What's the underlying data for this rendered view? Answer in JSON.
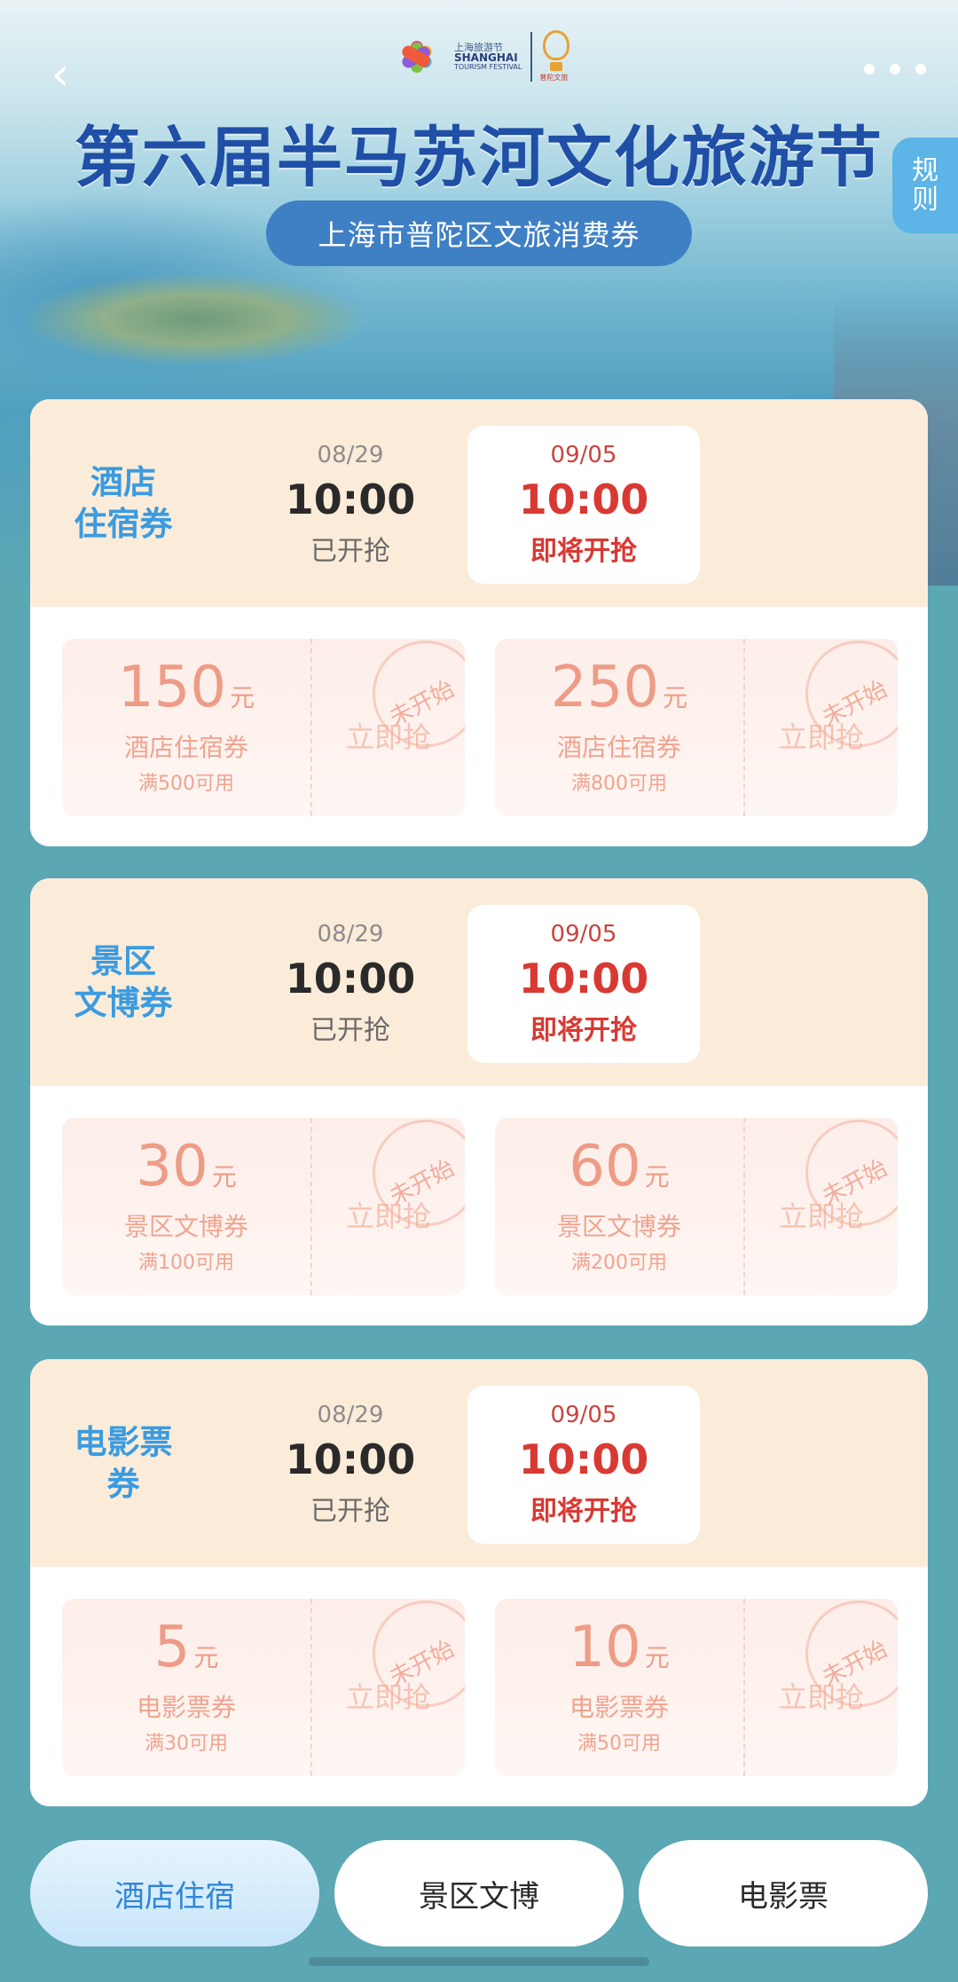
{
  "header": {
    "back_icon": "chevron-left-icon",
    "more_icon": "more-dots-icon",
    "logo": {
      "line1": "上海旅游节",
      "line2": "SHANGHAI",
      "line3": "TOURISM FESTIVAL",
      "right_caption": "普陀文旅"
    },
    "title": "第六届半马苏河文化旅游节",
    "subtitle": "上海市普陀区文旅消费券",
    "rules_label_1": "规",
    "rules_label_2": "则"
  },
  "sections": [
    {
      "title": "酒店\n住宿券",
      "slots": [
        {
          "date": "08/29",
          "time": "10:00",
          "status": "已开抢"
        },
        {
          "date": "09/05",
          "time": "10:00",
          "status": "即将开抢"
        }
      ],
      "coupons": [
        {
          "amount": "150",
          "unit": "元",
          "name": "酒店住宿券",
          "condition": "满500可用",
          "button": "立即抢",
          "stamp": "未开始"
        },
        {
          "amount": "250",
          "unit": "元",
          "name": "酒店住宿券",
          "condition": "满800可用",
          "button": "立即抢",
          "stamp": "未开始"
        }
      ]
    },
    {
      "title": "景区\n文博券",
      "slots": [
        {
          "date": "08/29",
          "time": "10:00",
          "status": "已开抢"
        },
        {
          "date": "09/05",
          "time": "10:00",
          "status": "即将开抢"
        }
      ],
      "coupons": [
        {
          "amount": "30",
          "unit": "元",
          "name": "景区文博券",
          "condition": "满100可用",
          "button": "立即抢",
          "stamp": "未开始"
        },
        {
          "amount": "60",
          "unit": "元",
          "name": "景区文博券",
          "condition": "满200可用",
          "button": "立即抢",
          "stamp": "未开始"
        }
      ]
    },
    {
      "title": "电影票\n券",
      "slots": [
        {
          "date": "08/29",
          "time": "10:00",
          "status": "已开抢"
        },
        {
          "date": "09/05",
          "time": "10:00",
          "status": "即将开抢"
        }
      ],
      "coupons": [
        {
          "amount": "5",
          "unit": "元",
          "name": "电影票券",
          "condition": "满30可用",
          "button": "立即抢",
          "stamp": "未开始"
        },
        {
          "amount": "10",
          "unit": "元",
          "name": "电影票券",
          "condition": "满50可用",
          "button": "立即抢",
          "stamp": "未开始"
        }
      ]
    }
  ],
  "tabs": [
    {
      "label": "酒店住宿",
      "active": true
    },
    {
      "label": "景区文博",
      "active": false
    },
    {
      "label": "电影票",
      "active": false
    }
  ],
  "colors": {
    "page_bg": "#5ba7b4",
    "section_head_bg": "#fbecd9",
    "section_title": "#3a9be0",
    "upcoming_red": "#d83a33",
    "coupon_amount": "#ee9c86",
    "tab_active_text": "#2f86d6",
    "title_blue": "#1f4fa6"
  }
}
